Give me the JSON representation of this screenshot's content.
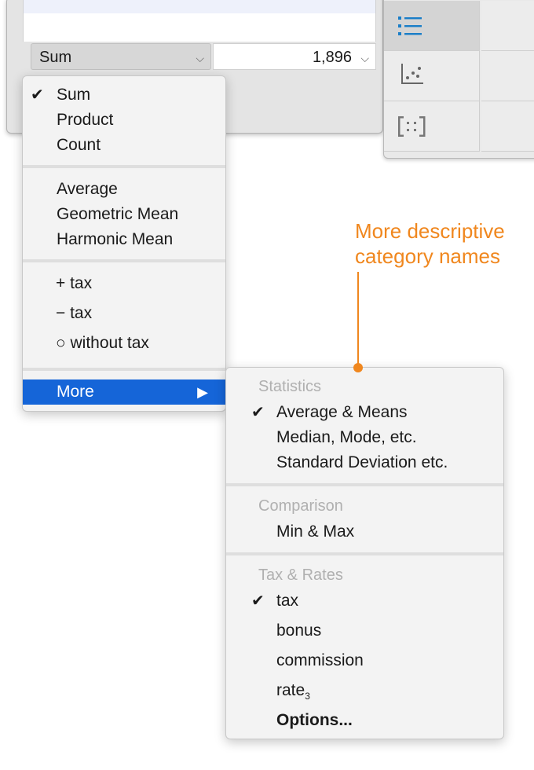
{
  "popup": {
    "selected": "Sum",
    "value": "1,896"
  },
  "aggregate_menu": {
    "group1": [
      "Sum",
      "Product",
      "Count"
    ],
    "checked": "Sum",
    "group2": [
      "Average",
      "Geometric Mean",
      "Harmonic Mean"
    ],
    "group3": [
      "+ tax",
      "− tax",
      "○ without tax"
    ],
    "more_label": "More"
  },
  "submenu": {
    "statistics_header": "Statistics",
    "statistics_items": [
      "Average & Means",
      "Median, Mode, etc.",
      "Standard Deviation etc."
    ],
    "comparison_header": "Comparison",
    "comparison_items": [
      "Min & Max"
    ],
    "tax_header": "Tax & Rates",
    "tax_items": [
      "tax",
      "bonus",
      "commission"
    ],
    "rate_label": "rate",
    "rate_subscript": "3",
    "options_label": "Options..."
  },
  "annotation": {
    "line1": "More descriptive",
    "line2": "category names"
  },
  "icons": [
    "list-icon",
    "scatter-plot-icon",
    "matrix-icon",
    "checkmark-icon",
    "chevron-down-icon",
    "submenu-arrow-icon"
  ],
  "colors": {
    "accent": "#1565d8",
    "annotation": "#f0871e",
    "icon": "#1a7ec8"
  }
}
